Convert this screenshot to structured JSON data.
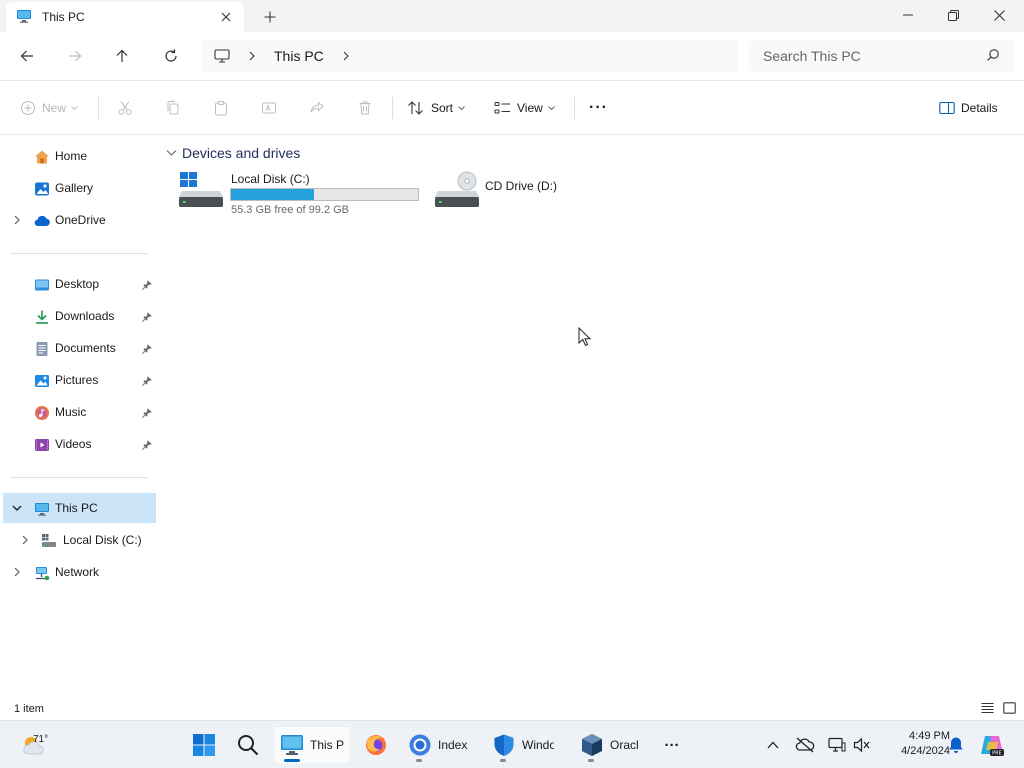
{
  "window": {
    "tab_title": "This PC",
    "close_tab_label": "×",
    "new_tab_label": "+"
  },
  "address": {
    "crumbs": [
      "This PC"
    ],
    "search_placeholder": "Search This PC"
  },
  "commands": {
    "new_label": "New",
    "sort_label": "Sort",
    "view_label": "View",
    "more_label": "···",
    "details_label": "Details"
  },
  "sidebar": {
    "top": [
      {
        "label": "Home",
        "icon": "home-icon"
      },
      {
        "label": "Gallery",
        "icon": "gallery-icon"
      },
      {
        "label": "OneDrive",
        "icon": "onedrive-icon"
      }
    ],
    "quick_access": [
      {
        "label": "Desktop",
        "icon": "desktop-icon"
      },
      {
        "label": "Downloads",
        "icon": "downloads-icon"
      },
      {
        "label": "Documents",
        "icon": "documents-icon"
      },
      {
        "label": "Pictures",
        "icon": "pictures-icon"
      },
      {
        "label": "Music",
        "icon": "music-icon"
      },
      {
        "label": "Videos",
        "icon": "videos-icon"
      }
    ],
    "tree": [
      {
        "label": "This PC",
        "icon": "this-pc-icon",
        "selected": true
      },
      {
        "label": "Local Disk (C:)",
        "icon": "local-disk-icon"
      },
      {
        "label": "Network",
        "icon": "network-icon"
      }
    ]
  },
  "content": {
    "group_title": "Devices and drives",
    "drives": [
      {
        "name": "Local Disk (C:)",
        "free_text": "55.3 GB free of 99.2 GB",
        "used_fraction": 0.443
      },
      {
        "name": "CD Drive (D:)"
      }
    ]
  },
  "status": {
    "item_count": "1 item"
  },
  "taskbar": {
    "weather_temp": "71°",
    "apps": [
      {
        "label": "This P",
        "icon": "file-explorer-icon"
      },
      {
        "label": "",
        "icon": "firefox-icon"
      },
      {
        "label": "Index",
        "icon": "chrome-icon"
      },
      {
        "label": "Windo",
        "icon": "windows-security-icon"
      },
      {
        "label": "Oracl",
        "icon": "virtualbox-icon"
      }
    ],
    "overflow_label": "···",
    "time": "4:49 PM",
    "date": "4/24/2024"
  },
  "colors": {
    "accent": "#0067c0",
    "selection": "#cce4f7",
    "drive_fill": "#26a0da"
  }
}
